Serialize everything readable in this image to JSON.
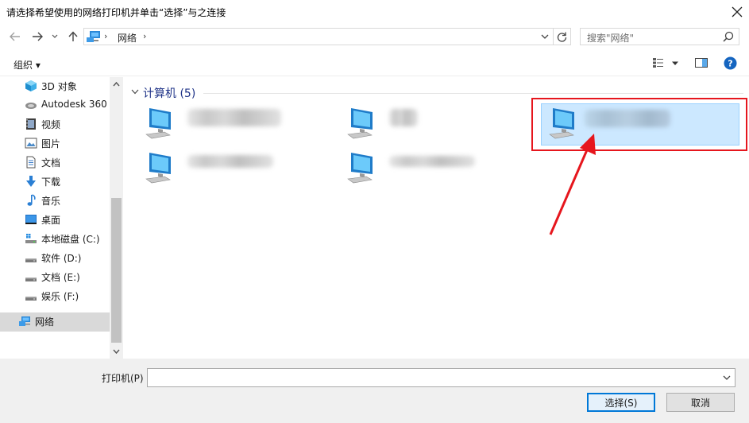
{
  "window": {
    "title": "请选择希望使用的网络打印机并单击“选择”与之连接"
  },
  "address": {
    "crumb": "网络",
    "search_placeholder": "搜索\"网络\""
  },
  "toolbar": {
    "organize_label": "组织 ▾"
  },
  "sidebar": {
    "items": [
      {
        "label": "3D 对象",
        "icon": "3d-objects-icon"
      },
      {
        "label": "Autodesk 360",
        "icon": "cloud-icon"
      },
      {
        "label": "视频",
        "icon": "video-icon"
      },
      {
        "label": "图片",
        "icon": "picture-icon"
      },
      {
        "label": "文档",
        "icon": "document-icon"
      },
      {
        "label": "下载",
        "icon": "download-icon"
      },
      {
        "label": "音乐",
        "icon": "music-icon"
      },
      {
        "label": "桌面",
        "icon": "desktop-icon"
      },
      {
        "label": "本地磁盘 (C:)",
        "icon": "windows-drive-icon"
      },
      {
        "label": "软件 (D:)",
        "icon": "drive-icon"
      },
      {
        "label": "文档 (E:)",
        "icon": "drive-icon"
      },
      {
        "label": "娱乐 (F:)",
        "icon": "drive-icon"
      },
      {
        "label": "网络",
        "icon": "network-icon"
      }
    ]
  },
  "content": {
    "group_title": "计算机 (5)",
    "computers": [
      {
        "name": "",
        "selected": false
      },
      {
        "name": "",
        "selected": false
      },
      {
        "name": "",
        "selected": true
      },
      {
        "name": "",
        "selected": false
      },
      {
        "name": "",
        "selected": false
      }
    ]
  },
  "footer": {
    "printer_label": "打印机(P)",
    "printer_value": "",
    "select_button": "选择(S)",
    "cancel_button": "取消"
  },
  "colors": {
    "selection_bg": "#cce8ff",
    "annotation_red": "#e6161d",
    "accent": "#0078d7",
    "group_header": "#1e3287"
  }
}
